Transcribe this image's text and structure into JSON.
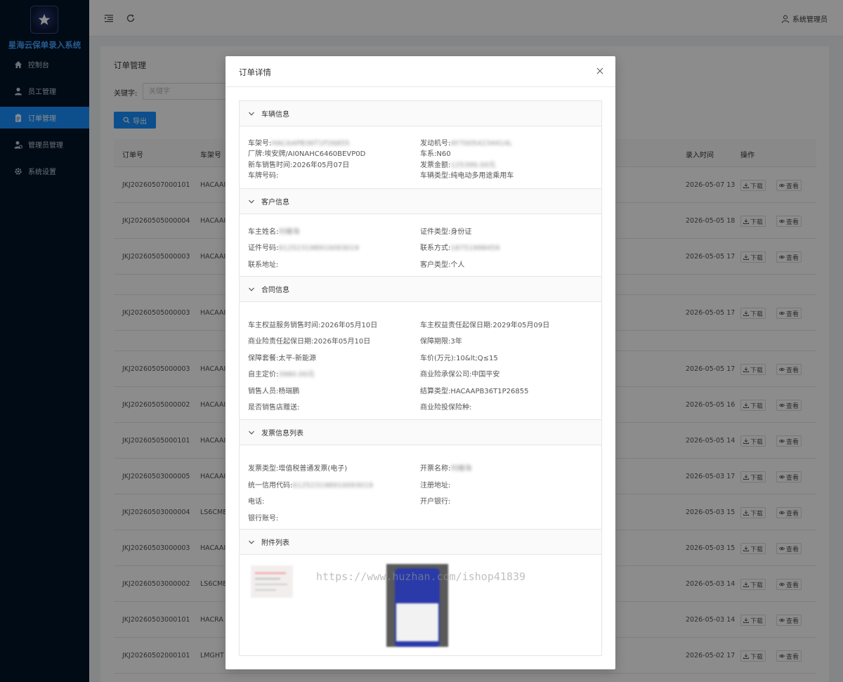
{
  "sidebar": {
    "title": "星海云保单录入系统",
    "items": [
      {
        "label": "控制台",
        "icon": "home-icon"
      },
      {
        "label": "员工管理",
        "icon": "user-icon"
      },
      {
        "label": "订单管理",
        "icon": "clipboard-icon",
        "active": true
      },
      {
        "label": "管理员管理",
        "icon": "admin-icon"
      },
      {
        "label": "系统设置",
        "icon": "gear-icon"
      }
    ]
  },
  "topbar": {
    "user": "系统管理员"
  },
  "page": {
    "title": "订单管理",
    "keyword_label": "关键字:",
    "keyword_placeholder": "关键字",
    "export_label": "导出"
  },
  "table": {
    "columns": {
      "order_no": "订单号",
      "vin": "车架号",
      "entry_time": "录入时间",
      "actions": "操作"
    },
    "download_label": "下载",
    "view_label": "查看",
    "rows": [
      {
        "order_no": "JKJ20260507000101",
        "vin": "HACAAI",
        "time": "2026-05-07 13"
      },
      {
        "order_no": "JKJ20260505000004",
        "vin": "HACAAI",
        "time": "2026-05-05 18"
      },
      {
        "order_no": "JKJ20260505000003",
        "vin": "HACAAI",
        "time": "2026-05-05 17"
      },
      {
        "order_no": "JKJ20260505000003",
        "vin": "HACAAI",
        "time": "2026-05-05 17"
      },
      {
        "order_no": "JKJ20260505000003",
        "vin": "HACAAI",
        "time": "2026-05-05 17"
      },
      {
        "order_no": "JKJ20260505000002",
        "vin": "HACAAI",
        "time": "2026-05-05 16"
      },
      {
        "order_no": "JKJ20260505000101",
        "vin": "HACAAI",
        "time": "2026-05-05 14"
      },
      {
        "order_no": "JKJ20260503000005",
        "vin": "HACAAI",
        "time": "2026-05-03 17"
      },
      {
        "order_no": "JKJ20260503000004",
        "vin": "LS6CME",
        "time": "2026-05-03 15"
      },
      {
        "order_no": "JKJ20260503000003",
        "vin": "HACAAI",
        "time": "2026-05-03 15"
      },
      {
        "order_no": "JKJ20260503000002",
        "vin": "LS6CME",
        "time": "2026-05-03 14"
      },
      {
        "order_no": "JKJ20260503000101",
        "vin": "HACRA",
        "time": "2026-05-03 14"
      },
      {
        "order_no": "JKJ20260502000101",
        "vin": "LMGHT",
        "time": "2026-05-02 17"
      }
    ]
  },
  "modal": {
    "title": "订单详情",
    "vehicle": {
      "title": "车辆信息",
      "vin_label": "车架号:",
      "vin": "HACAAPB36T1P26855",
      "engine_label": "发动机号:",
      "engine": "AY70054234414L",
      "brand_label": "厂牌:",
      "brand": "埃安牌/AI0NAHC6460BEVP0D",
      "series_label": "车系:",
      "series": "N60",
      "sale_time_label": "新车销售时间:",
      "sale_time": "2026年05月07日",
      "invoice_amount_label": "发票金额:",
      "invoice_amount": "125399.00元",
      "plate_label": "车牌号码:",
      "type_label": "车辆类型:",
      "type": "纯电动多用途乘用车"
    },
    "customer": {
      "title": "客户信息",
      "owner_label": "车主姓名:",
      "owner": "刘椿海",
      "id_type_label": "证件类型:",
      "id_type": "身份证",
      "id_no_label": "证件号码:",
      "id_no": "612523198910093019",
      "phone_label": "联系方式:",
      "phone": "18751998459",
      "address_label": "联系地址:",
      "cust_type_label": "客户类型:",
      "cust_type": "个人"
    },
    "contract": {
      "title": "合同信息",
      "service_time_label": "车主权益服务销售时间:",
      "service_time": "2026年05月10日",
      "liability_start_label": "车主权益责任起保日期:",
      "liability_start": "2029年05月09日",
      "commercial_start_label": "商业险责任起保日期:",
      "commercial_start": "2026年05月10日",
      "period_label": "保障期限:",
      "period": "3年",
      "package_label": "保障套餐:",
      "package": "太平-新能源",
      "price_label": "车价(万元):",
      "price": "10&lt;Q≤15",
      "custom_price_label": "自主定价:",
      "custom_price": "3980.00元",
      "insurer_label": "商业险承保公司:",
      "insurer": "中国平安",
      "sales_label": "销售人员:",
      "sales": "杨瑞鹏",
      "settle_label": "结算类型:",
      "settle": "HACAAPB36T1P26855",
      "gift_label": "是否销售店赠送:",
      "insure_type_label": "商业险投保险种:"
    },
    "invoice": {
      "title": "发票信息列表",
      "inv_type_label": "发票类型:",
      "inv_type": "增值税普通发票(电子)",
      "inv_name_label": "开票名称:",
      "inv_name": "刘椿海",
      "credit_code_label": "统一信用代码:",
      "credit_code": "612523198910093019",
      "reg_addr_label": "注册地址:",
      "tel_label": "电话:",
      "bank_label": "开户银行:",
      "account_label": "银行账号:"
    },
    "attachments": {
      "title": "附件列表"
    }
  },
  "watermark": "https://www.huzhan.com/ishop41839",
  "colors": {
    "sidebar": "#001529",
    "accent": "#1890ff",
    "title": "#4aa3ff"
  }
}
